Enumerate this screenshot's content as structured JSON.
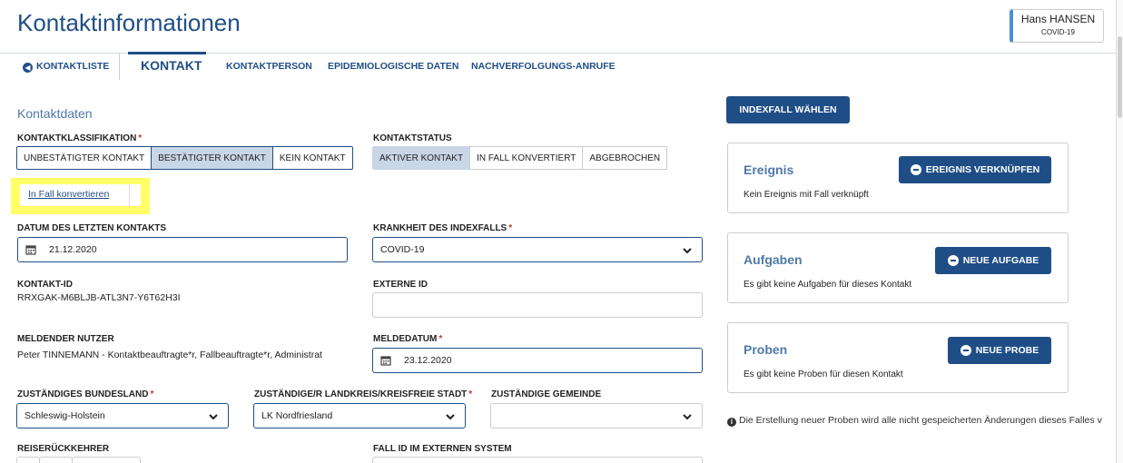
{
  "page": {
    "title": "Kontaktinformationen"
  },
  "user": {
    "name": "Hans HANSEN",
    "disease": "COVID-19"
  },
  "tabs": {
    "back_label": "KONTAKTLISTE",
    "active": "KONTAKT",
    "items": [
      "KONTAKTPERSON",
      "EPIDEMIOLOGISCHE DATEN",
      "NACHVERFOLGUNGS-ANRUFE"
    ]
  },
  "section": {
    "title": "Kontaktdaten"
  },
  "classification": {
    "label": "KONTAKTKLASSIFIKATION",
    "required_mark": "*",
    "options": [
      "UNBESTÄTIGTER KONTAKT",
      "BESTÄTIGTER KONTAKT",
      "KEIN KONTAKT"
    ],
    "selected": "BESTÄTIGTER KONTAKT"
  },
  "status": {
    "label": "KONTAKTSTATUS",
    "options": [
      "AKTIVER KONTAKT",
      "IN FALL KONVERTIERT",
      "ABGEBROCHEN"
    ],
    "selected": "AKTIVER KONTAKT"
  },
  "convert_link": "In Fall konvertieren",
  "last_contact": {
    "label": "DATUM DES LETZTEN KONTAKTS",
    "value": "21.12.2020"
  },
  "index_disease": {
    "label": "KRANKHEIT DES INDEXFALLS",
    "required_mark": "*",
    "value": "COVID-19"
  },
  "contact_id": {
    "label": "KONTAKT-ID",
    "value": "RRXGAK-M6BLJB-ATL3N7-Y6T62H3I"
  },
  "external_id": {
    "label": "EXTERNE ID",
    "value": ""
  },
  "reporting_user": {
    "label": "MELDENDER NUTZER",
    "value": "Peter TINNEMANN - Kontaktbeauftragte*r, Fallbeauftragte*r, Administrat"
  },
  "report_date": {
    "label": "MELDEDATUM",
    "required_mark": "*",
    "value": "23.12.2020"
  },
  "state": {
    "label": "ZUSTÄNDIGES BUNDESLAND",
    "required_mark": "*",
    "value": "Schleswig-Holstein"
  },
  "district": {
    "label": "ZUSTÄNDIGE/R LANDKREIS/KREISFREIE STADT",
    "required_mark": "*",
    "value": "LK Nordfriesland"
  },
  "community": {
    "label": "ZUSTÄNDIGE GEMEINDE",
    "value": ""
  },
  "traveler": {
    "label": "REISERÜCKKEHRER"
  },
  "external_case_id": {
    "label": "FALL ID IM EXTERNEN SYSTEM"
  },
  "side": {
    "choose_index_button": "INDEXFALL WÄHLEN",
    "event": {
      "title": "Ereignis",
      "button": "EREIGNIS VERKNÜPFEN",
      "text": "Kein Ereignis mit Fall verknüpft"
    },
    "tasks": {
      "title": "Aufgaben",
      "button": "NEUE AUFGABE",
      "text": "Es gibt keine Aufgaben für dieses Kontakt"
    },
    "samples": {
      "title": "Proben",
      "button": "NEUE PROBE",
      "text": "Es gibt keine Proben für diesen Kontakt"
    },
    "info": "Die Erstellung neuer Proben wird alle nicht gespeicherten Änderungen dieses Falles v"
  },
  "colors": {
    "primary": "#1f4e87",
    "section_title": "#4f7aa8",
    "selected_option": "#c9d6e6",
    "required": "#c0392b",
    "highlight": "#ffff66"
  }
}
